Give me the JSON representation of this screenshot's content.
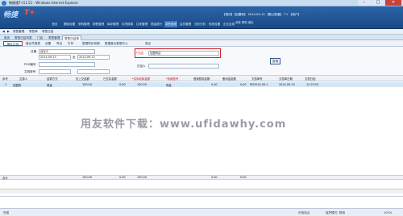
{
  "window": {
    "title": "畅捷通T+11.51 - Windows Internet Explorer",
    "status_line": "【测试】【加盟商】 2014-09-13 【默认账套】 T+ 【用户】"
  },
  "header": {
    "logo_text": "T+",
    "logo_sub": "畅捷",
    "menu": [
      "首页",
      "基础设置",
      "采购管理",
      "销售管理",
      "库存管理",
      "存货核算",
      "往来管理",
      "现金银行",
      "零售管理",
      "会员管理",
      "业务分析",
      "系统设置",
      "企业应用"
    ],
    "mini_menu": "消息  帮助  退出"
  },
  "funcbar": {
    "items": [
      "◀",
      "▶",
      "零售管理",
      "零售单",
      "零售日结"
    ]
  },
  "tabs": [
    "首页",
    "零售日结列表",
    "门店",
    "零售管理",
    "零售日结单"
  ],
  "active_tab_index": 4,
  "toolbar": {
    "confirm_label": "确认日结",
    "items": [
      "营业员报表",
      "设置",
      "导出",
      "打印",
      "数据同步到期",
      "数据营业数据中心",
      "退出"
    ]
  },
  "filter": {
    "date_label": "日期",
    "date_type": "自定义",
    "date_from": "2014-09-13",
    "date_to": "2014-09-13",
    "to_label": "至",
    "store_label": "*门店",
    "store_value": "加盟商店",
    "pos_label": "POS编号",
    "doc_label": "文档单号",
    "doc_value": "",
    "operator_label": "日结人",
    "operator_value": "",
    "search_label": "查询"
  },
  "grid": {
    "headers": [
      "序号",
      "交易人",
      "结算方式",
      "应上交金额",
      "已交实金额",
      "*实际收款金额",
      "*收款账号",
      "借销暂用金额",
      "备用金金额",
      "文档单号",
      "文档单日期",
      "文档日结"
    ],
    "required_cols": [
      5,
      6
    ],
    "rows": [
      [
        "1",
        "加盟商",
        "现金",
        "150.00",
        "0.00",
        "150.00",
        "现金",
        "0.00",
        "0.00",
        "RD2014-09-1",
        "2014-09-13",
        "12:25:53"
      ]
    ],
    "total_label": "合计",
    "totals": [
      "150.00",
      "0.00",
      "150.00",
      "0.00",
      "0.00"
    ]
  },
  "watermark": "用友软件下载：www.ufidawhy.com",
  "statusbar": {
    "left": "完成",
    "trusted": "可信站点",
    "protected": "保护模式: 禁用",
    "zoom": "100%"
  }
}
